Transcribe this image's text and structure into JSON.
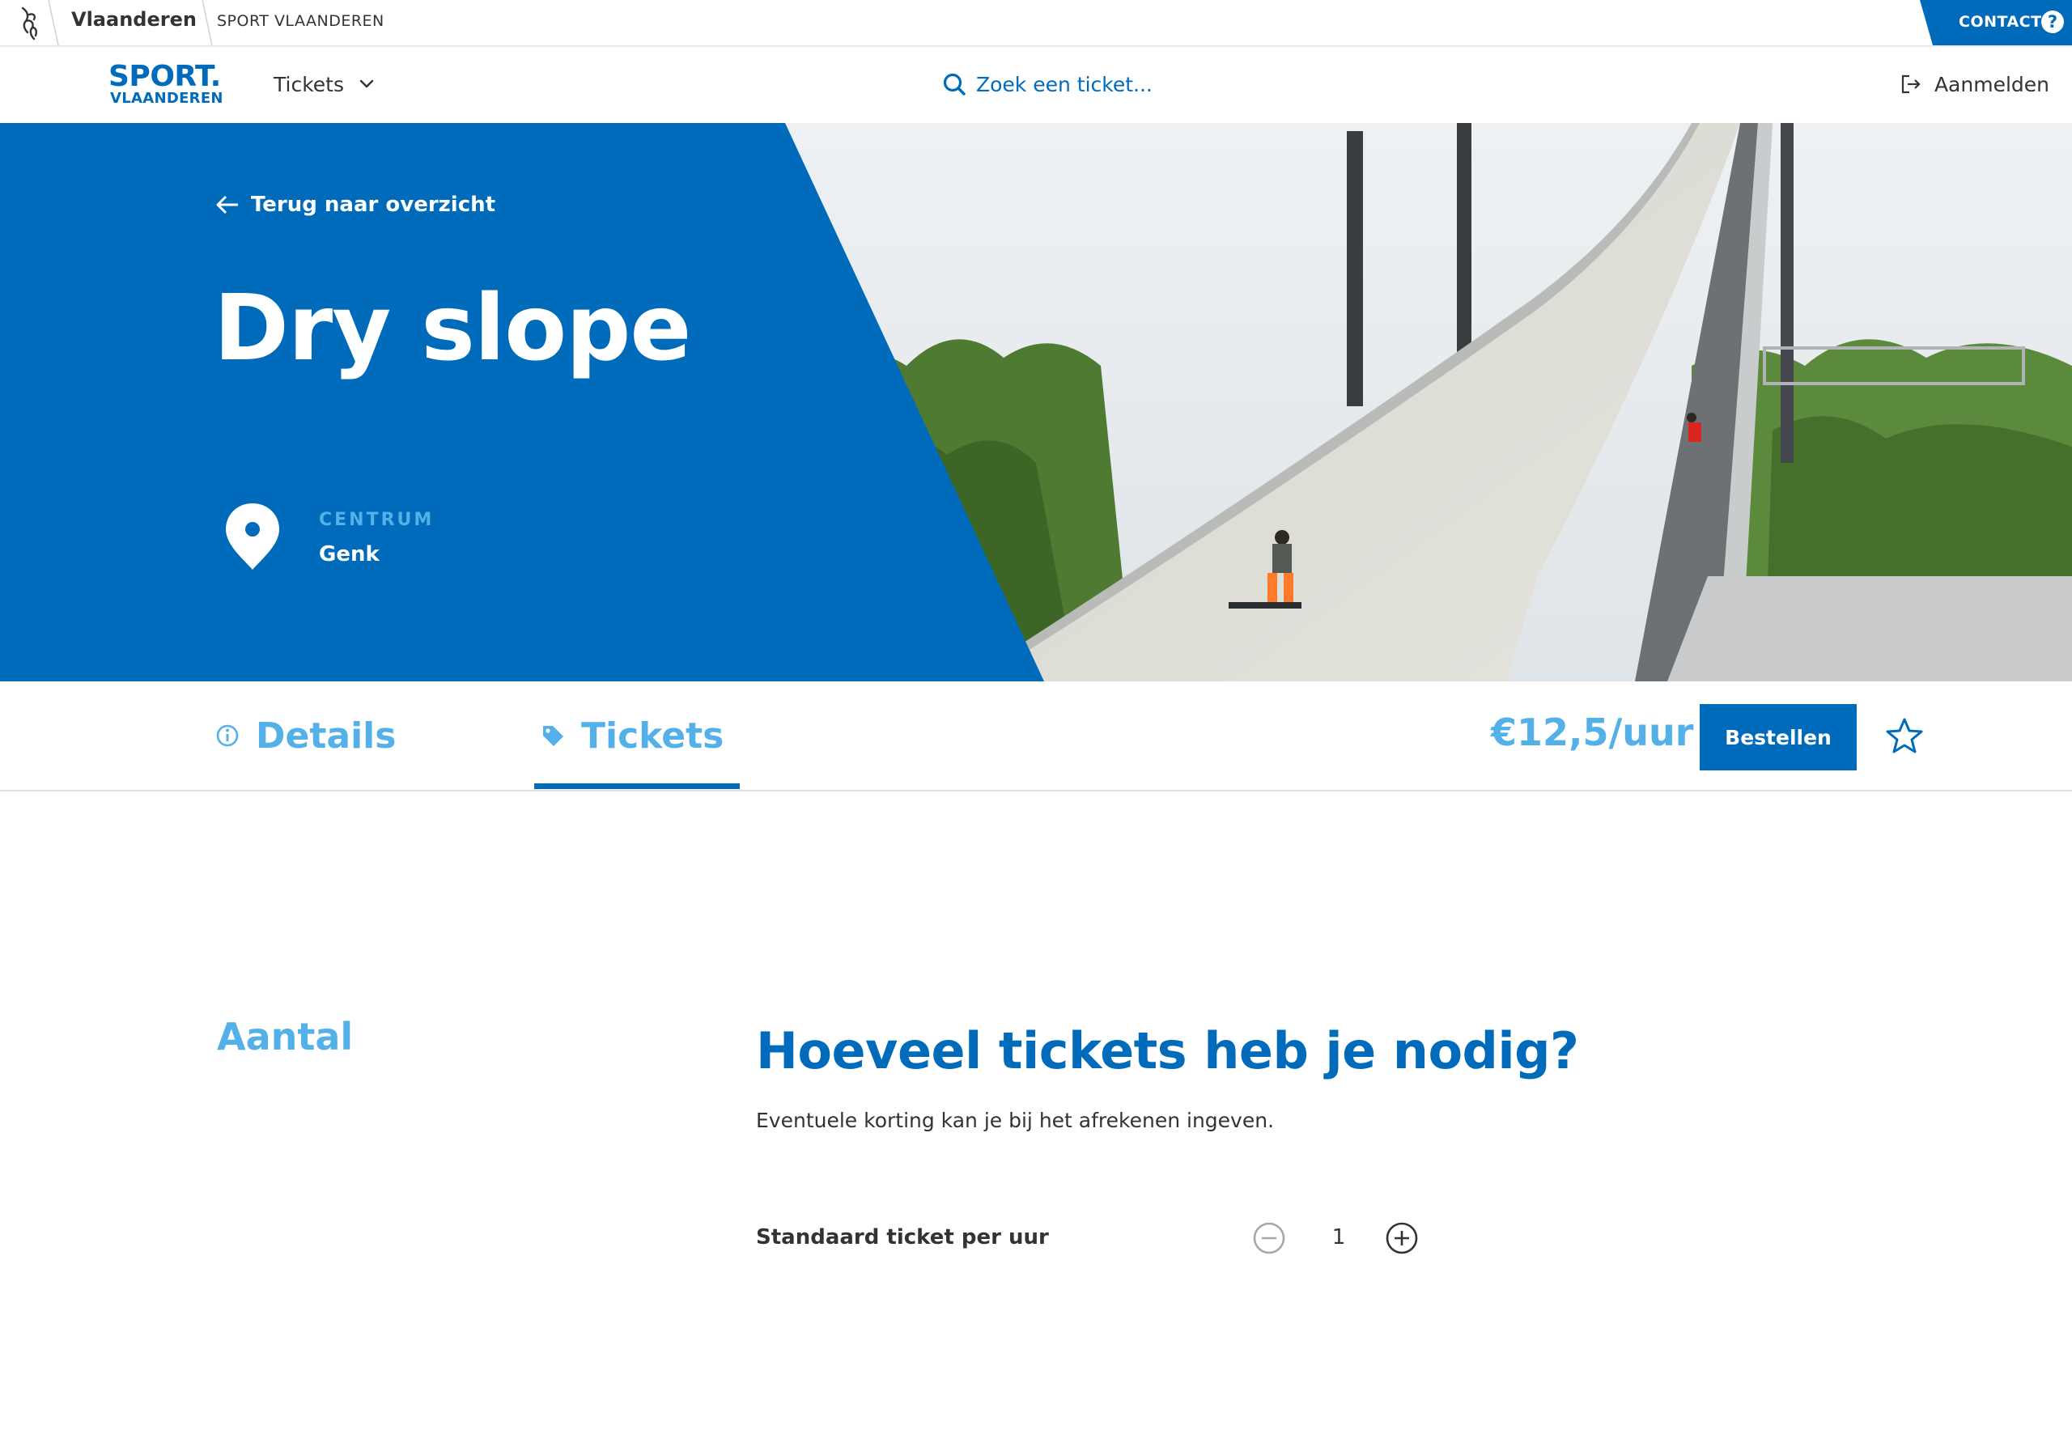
{
  "gov_bar": {
    "vlaanderen": "Vlaanderen",
    "sport_vlaanderen": "SPORT VLAANDEREN",
    "contact_label": "CONTACT",
    "contact_icon": "question-circle-icon"
  },
  "header": {
    "logo_line1": "SPORT.",
    "logo_line2": "VLAANDEREN",
    "nav_tickets": "Tickets",
    "search_placeholder": "Zoek een ticket...",
    "login_label": "Aanmelden"
  },
  "hero": {
    "back_label": "Terug naar overzicht",
    "title": "Dry slope",
    "location_label": "CENTRUM",
    "location_value": "Genk"
  },
  "tabs": [
    {
      "label": "Details",
      "icon": "info-icon",
      "active": false
    },
    {
      "label": "Tickets",
      "icon": "tag-icon",
      "active": true
    }
  ],
  "tabs_bar": {
    "price": "€12,5/uur",
    "order_label": "Bestellen",
    "favorite_icon": "star-icon"
  },
  "content": {
    "side_heading": "Aantal",
    "heading": "Hoeveel tickets heb je nodig?",
    "subtext": "Eventuele korting kan je bij het afrekenen ingeven.",
    "tickets": [
      {
        "name": "Standaard ticket per uur",
        "quantity": "1"
      }
    ]
  },
  "colors": {
    "primary_blue": "#006bbb",
    "light_blue": "#53b0e8",
    "text_dark": "#333332"
  }
}
